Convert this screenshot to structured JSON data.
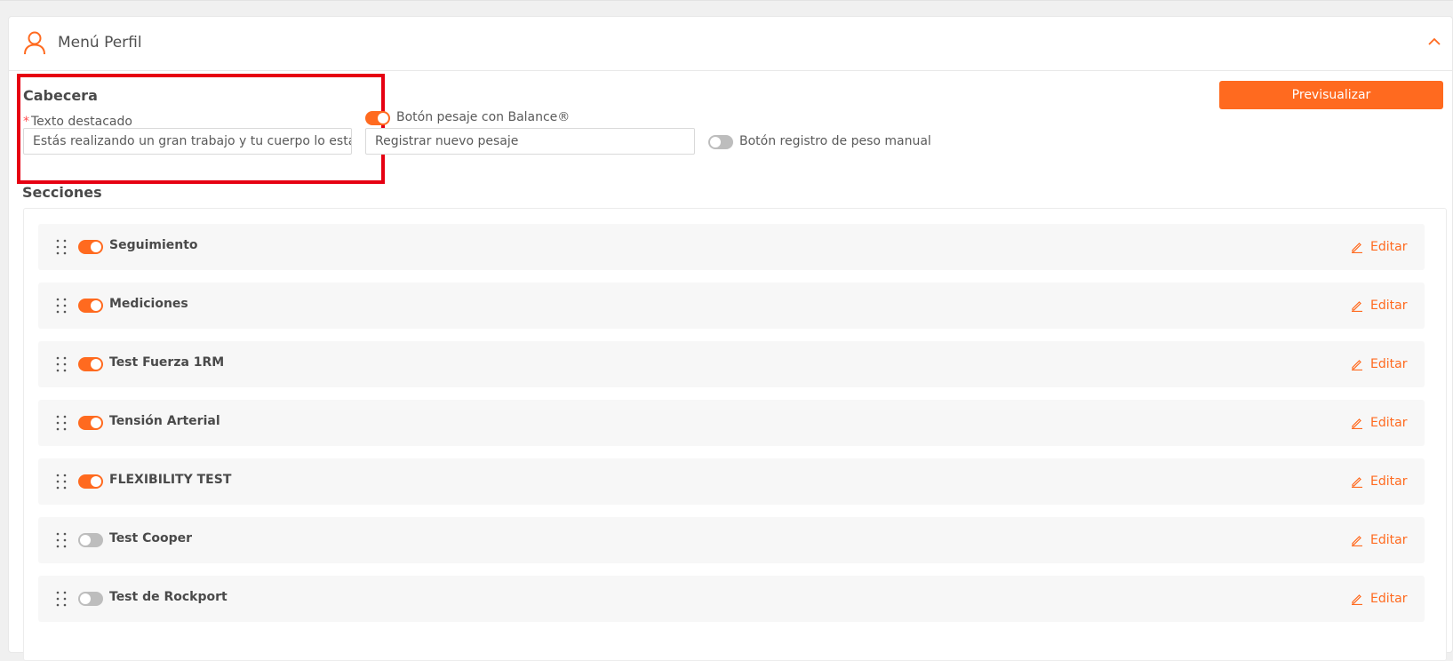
{
  "card": {
    "title": "Menú Perfil",
    "icons": {
      "header": "user-icon",
      "collapse": "chevron-up-icon"
    }
  },
  "header_section": {
    "heading": "Cabecera",
    "required_mark": "*",
    "featured_text_label": "Texto destacado",
    "featured_text_value": "Estás realizando un gran trabajo y tu cuerpo lo está notando"
  },
  "weigh_button": {
    "label": "Botón pesaje con Balance®",
    "enabled": true,
    "text_value": "Registrar nuevo pesaje"
  },
  "manual_weight_button": {
    "label": "Botón registro de peso manual",
    "enabled": false
  },
  "preview_button": {
    "label": "Previsualizar"
  },
  "sections": {
    "heading": "Secciones",
    "edit_label": "Editar",
    "items": [
      {
        "name": "Seguimiento",
        "enabled": true
      },
      {
        "name": "Mediciones",
        "enabled": true
      },
      {
        "name": "Test Fuerza 1RM",
        "enabled": true
      },
      {
        "name": "Tensión Arterial",
        "enabled": true
      },
      {
        "name": "FLEXIBILITY TEST",
        "enabled": true
      },
      {
        "name": "Test Cooper",
        "enabled": false
      },
      {
        "name": "Test de Rockport",
        "enabled": false
      }
    ]
  },
  "colors": {
    "accent": "#ff6a1f",
    "toggle_off": "#bdbdbd",
    "highlight_border": "#e60012",
    "row_background": "#f7f7f7"
  }
}
